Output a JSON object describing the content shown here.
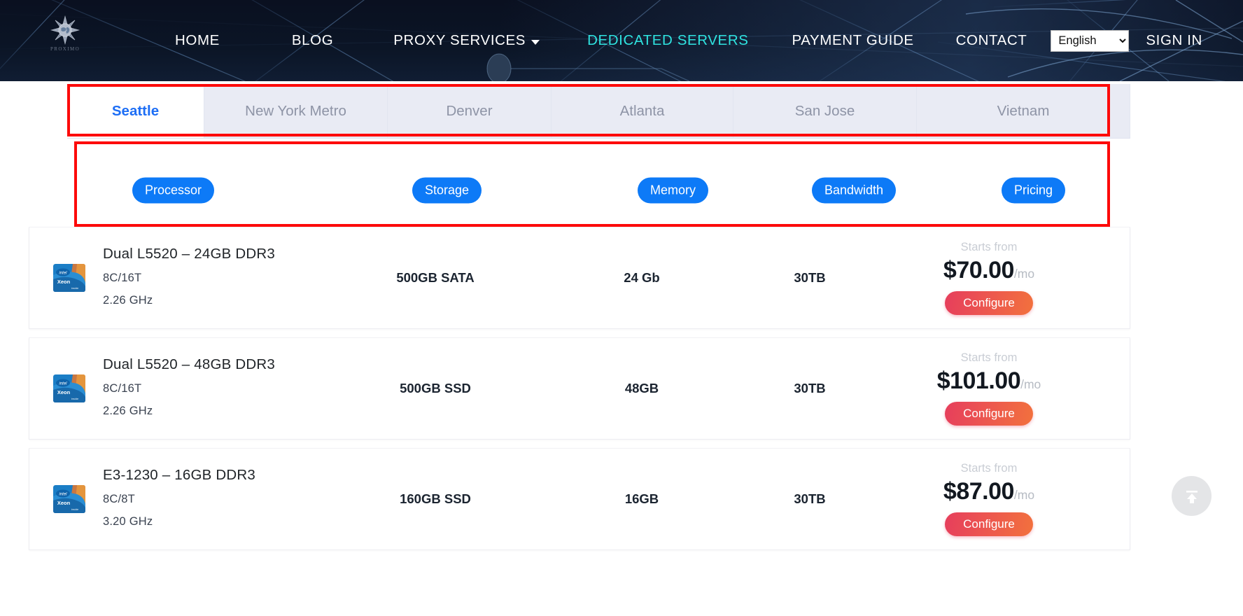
{
  "header": {
    "logo_text": "PROXIMO",
    "nav": [
      {
        "label": "HOME",
        "active": false,
        "has_caret": false
      },
      {
        "label": "BLOG",
        "active": false,
        "has_caret": false
      },
      {
        "label": "PROXY SERVICES",
        "active": false,
        "has_caret": true
      },
      {
        "label": "DEDICATED SERVERS",
        "active": true,
        "has_caret": false
      },
      {
        "label": "PAYMENT GUIDE",
        "active": false,
        "has_caret": false
      },
      {
        "label": "CONTACT",
        "active": false,
        "has_caret": false
      }
    ],
    "language": {
      "selected": "English",
      "options": [
        "English"
      ]
    },
    "sign_in_label": "SIGN IN",
    "active_color": "#2fe3e0"
  },
  "location_tabs": {
    "active_index": 0,
    "items": [
      {
        "label": "Seattle"
      },
      {
        "label": "New York Metro"
      },
      {
        "label": "Denver"
      },
      {
        "label": "Atlanta"
      },
      {
        "label": "San Jose"
      },
      {
        "label": "Vietnam"
      }
    ],
    "active_color": "#1d6ef5",
    "inactive_color": "#8e94a6"
  },
  "filter_pills": {
    "color": "#0d7af7",
    "items": [
      {
        "label": "Processor"
      },
      {
        "label": "Storage"
      },
      {
        "label": "Memory"
      },
      {
        "label": "Bandwidth"
      },
      {
        "label": "Pricing"
      }
    ]
  },
  "servers": {
    "starts_from_label": "Starts from",
    "per_mo_label": "/mo",
    "configure_label": "Configure",
    "cpu_icon_label": "intel Xeon",
    "rows": [
      {
        "title": "Dual L5520 – 24GB DDR3",
        "cores": "8C/16T",
        "clock": "2.26 GHz",
        "storage": "500GB SATA",
        "memory": "24 Gb",
        "bandwidth": "30TB",
        "price": "$70.00"
      },
      {
        "title": "Dual L5520 – 48GB DDR3",
        "cores": "8C/16T",
        "clock": "2.26 GHz",
        "storage": "500GB SSD",
        "memory": "48GB",
        "bandwidth": "30TB",
        "price": "$101.00"
      },
      {
        "title": "E3-1230 – 16GB DDR3",
        "cores": "8C/8T",
        "clock": "3.20 GHz",
        "storage": "160GB SSD",
        "memory": "16GB",
        "bandwidth": "30TB",
        "price": "$87.00"
      }
    ]
  },
  "annotations": {
    "highlight_color": "#fd0a0a",
    "boxes": [
      "location-tabs-highlight",
      "filter-pills-highlight"
    ]
  },
  "scroll_top": {
    "icon": "arrow-up-to-line-icon"
  }
}
